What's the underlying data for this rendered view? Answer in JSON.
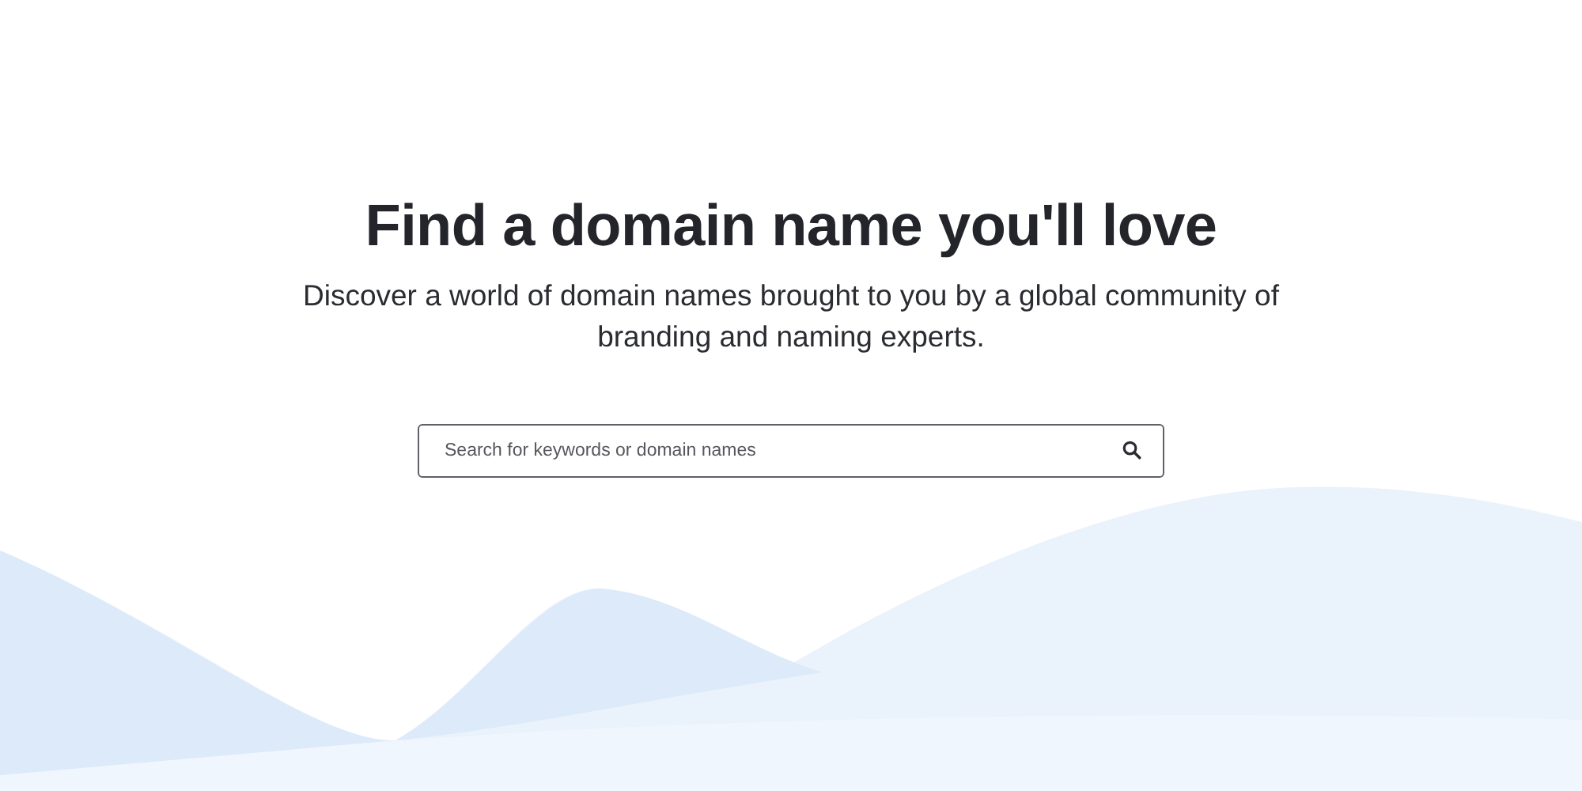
{
  "hero": {
    "title": "Find a domain name you'll love",
    "subtitle": "Discover a world of domain names brought to you by a global community of branding and naming experts."
  },
  "search": {
    "placeholder": "Search for keywords or domain names"
  }
}
